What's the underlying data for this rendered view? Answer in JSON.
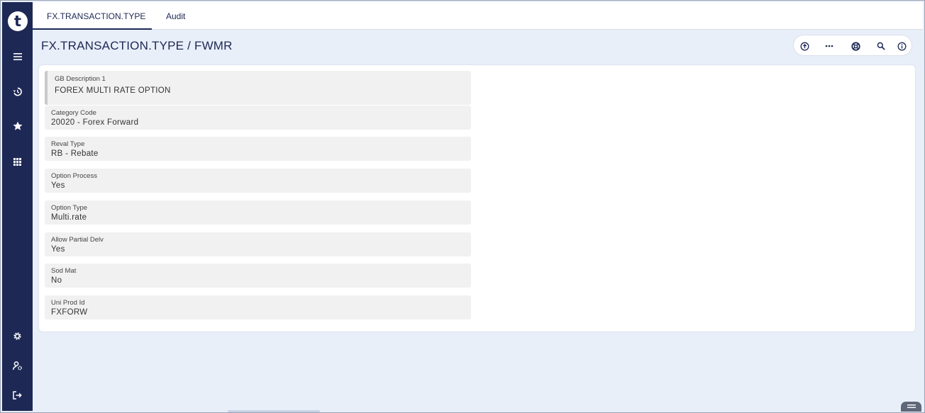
{
  "app": {
    "logo_letter": "t",
    "accent_color": "#1d2855"
  },
  "tabs": [
    {
      "label": "FX.TRANSACTION.TYPE",
      "active": true
    },
    {
      "label": "Audit",
      "active": false
    }
  ],
  "page": {
    "title": "FX.TRANSACTION.TYPE / FWMR"
  },
  "sidebar": {
    "items": [
      {
        "icon": "menu-icon"
      },
      {
        "icon": "history-icon"
      },
      {
        "icon": "star-icon"
      },
      {
        "icon": "apps-grid-icon"
      },
      {
        "icon": "settings-icon"
      },
      {
        "icon": "user-settings-icon"
      },
      {
        "icon": "logout-icon"
      }
    ]
  },
  "toolbar": {
    "icons": [
      "upload-icon",
      "more-icon",
      "help-icon",
      "search-icon",
      "info-icon"
    ]
  },
  "fields": [
    {
      "label": "GB Description 1",
      "value": "FOREX MULTI RATE OPTION"
    },
    {
      "label": "Category Code",
      "value": "20020 - Forex Forward"
    },
    {
      "label": "Reval Type",
      "value": "RB - Rebate"
    },
    {
      "label": "Option Process",
      "value": "Yes"
    },
    {
      "label": "Option Type",
      "value": "Multi.rate"
    },
    {
      "label": "Allow Partial Delv",
      "value": "Yes"
    },
    {
      "label": "Sod Mat",
      "value": "No"
    },
    {
      "label": "Uni Prod Id",
      "value": "FXFORW"
    }
  ]
}
